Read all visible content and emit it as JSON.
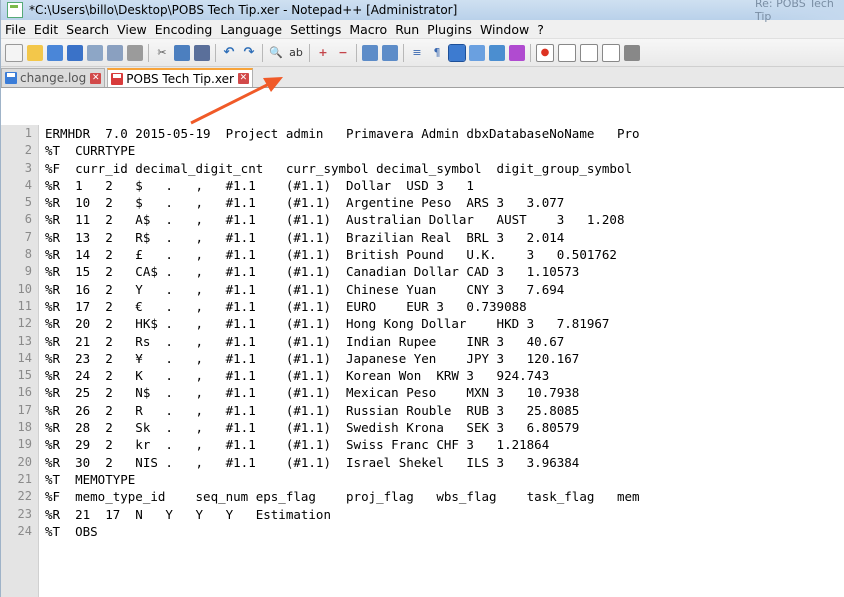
{
  "window": {
    "title": "*C:\\Users\\billo\\Desktop\\POBS Tech Tip.xer - Notepad++ [Administrator]",
    "ghost_title": "Re: POBS Tech Tip"
  },
  "menu": [
    "File",
    "Edit",
    "Search",
    "View",
    "Encoding",
    "Language",
    "Settings",
    "Macro",
    "Run",
    "Plugins",
    "Window",
    "?"
  ],
  "toolbar": {
    "icons": [
      "new-file-icon",
      "open-file-icon",
      "save-icon",
      "save-all-icon",
      "close-icon",
      "close-all-icon",
      "print-icon",
      "cut-icon",
      "copy-icon",
      "paste-icon",
      "undo-icon",
      "redo-icon",
      "find-icon",
      "replace-icon",
      "zoom-in-icon",
      "zoom-out-icon",
      "sync-vertical-icon",
      "sync-horizontal-icon",
      "word-wrap-icon",
      "show-all-chars-icon",
      "indent-guide-icon",
      "user-defined-language-icon",
      "document-map-icon",
      "function-list-icon",
      "record-macro-icon",
      "stop-recording-icon",
      "playback-icon",
      "run-macro-multiple-icon",
      "save-macro-icon"
    ]
  },
  "tabs": [
    {
      "label": "change.log",
      "active": false
    },
    {
      "label": "POBS Tech Tip.xer",
      "active": true
    }
  ],
  "editor": {
    "line_numbers": [
      "1",
      "2",
      "3",
      "4",
      "5",
      "6",
      "7",
      "8",
      "9",
      "10",
      "11",
      "12",
      "13",
      "14",
      "15",
      "16",
      "17",
      "18",
      "19",
      "20",
      "21",
      "22",
      "23",
      "24"
    ],
    "lines": [
      "ERMHDR  7.0 2015-05-19  Project admin   Primavera Admin dbxDatabaseNoName   Pro",
      "%T  CURRTYPE",
      "%F  curr_id decimal_digit_cnt   curr_symbol decimal_symbol  digit_group_symbol",
      "%R  1   2   $   .   ,   #1.1    (#1.1)  Dollar  USD 3   1",
      "%R  10  2   $   .   ,   #1.1    (#1.1)  Argentine Peso  ARS 3   3.077",
      "%R  11  2   A$  .   ,   #1.1    (#1.1)  Australian Dollar   AUST    3   1.208",
      "%R  13  2   R$  .   ,   #1.1    (#1.1)  Brazilian Real  BRL 3   2.014",
      "%R  14  2   £   .   ,   #1.1    (#1.1)  British Pound   U.K.    3   0.501762",
      "%R  15  2   CA$ .   ,   #1.1    (#1.1)  Canadian Dollar CAD 3   1.10573",
      "%R  16  2   Y   .   ,   #1.1    (#1.1)  Chinese Yuan    CNY 3   7.694",
      "%R  17  2   €   .   ,   #1.1    (#1.1)  EURO    EUR 3   0.739088",
      "%R  20  2   HK$ .   ,   #1.1    (#1.1)  Hong Kong Dollar    HKD 3   7.81967",
      "%R  21  2   Rs  .   ,   #1.1    (#1.1)  Indian Rupee    INR 3   40.67",
      "%R  23  2   ¥   .   ,   #1.1    (#1.1)  Japanese Yen    JPY 3   120.167",
      "%R  24  2   K   .   ,   #1.1    (#1.1)  Korean Won  KRW 3   924.743",
      "%R  25  2   N$  .   ,   #1.1    (#1.1)  Mexican Peso    MXN 3   10.7938",
      "%R  26  2   R   .   ,   #1.1    (#1.1)  Russian Rouble  RUB 3   25.8085",
      "%R  28  2   Sk  .   ,   #1.1    (#1.1)  Swedish Krona   SEK 3   6.80579",
      "%R  29  2   kr  .   ,   #1.1    (#1.1)  Swiss Franc CHF 3   1.21864",
      "%R  30  2   NIS .   ,   #1.1    (#1.1)  Israel Shekel   ILS 3   3.96384",
      "%T  MEMOTYPE",
      "%F  memo_type_id    seq_num eps_flag    proj_flag   wbs_flag    task_flag   mem",
      "%R  21  17  N   Y   Y   Y   Estimation",
      "%T  OBS"
    ]
  },
  "colors": {
    "annotation_arrow": "#f05a28",
    "active_tab_accent": "#f7a33a"
  }
}
